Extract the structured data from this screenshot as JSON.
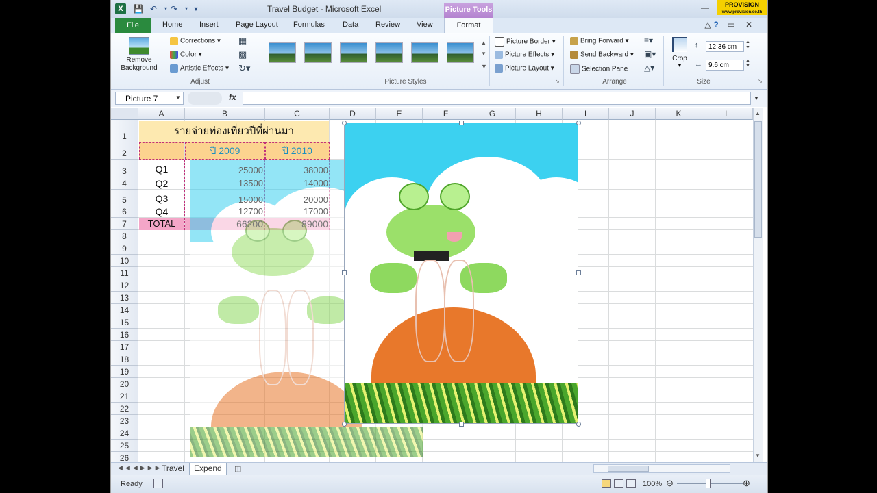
{
  "titlebar": {
    "title": "Travel Budget  -  Microsoft Excel",
    "contextual_tab": "Picture Tools",
    "brand": "PROVISION",
    "brand_sub": "www.provision.co.th"
  },
  "tabs": [
    "File",
    "Home",
    "Insert",
    "Page Layout",
    "Formulas",
    "Data",
    "Review",
    "View",
    "Format"
  ],
  "ribbon": {
    "adjust": {
      "remove_background": "Remove Background",
      "corrections": "Corrections",
      "color": "Color",
      "artistic_effects": "Artistic Effects",
      "label": "Adjust"
    },
    "picture_styles": {
      "label": "Picture Styles",
      "count": 6
    },
    "picture_options": {
      "border": "Picture Border",
      "effects": "Picture Effects",
      "layout": "Picture Layout"
    },
    "arrange": {
      "bring_forward": "Bring Forward",
      "send_backward": "Send Backward",
      "selection_pane": "Selection Pane",
      "label": "Arrange"
    },
    "size": {
      "crop": "Crop",
      "height": "12.36 cm",
      "width": "9.6 cm",
      "label": "Size"
    }
  },
  "formula_bar": {
    "name_box": "Picture 7",
    "fx": "fx",
    "value": ""
  },
  "columns": [
    "A",
    "B",
    "C",
    "D",
    "E",
    "F",
    "G",
    "H",
    "I",
    "J",
    "K",
    "L"
  ],
  "rows": [
    "1",
    "2",
    "3",
    "4",
    "5",
    "6",
    "7",
    "8",
    "9",
    "10",
    "11",
    "12",
    "13",
    "14",
    "15",
    "16",
    "17",
    "18",
    "19",
    "20",
    "21",
    "22",
    "23",
    "24",
    "25",
    "26"
  ],
  "sheet": {
    "title": "รายจ่ายท่องเที่ยวปีที่ผ่านมา",
    "year1": "ปี 2009",
    "year2": "ปี 2010",
    "table": [
      {
        "label": "Q1",
        "v2009": "25000",
        "v2010": "38000"
      },
      {
        "label": "Q2",
        "v2009": "13500",
        "v2010": "14000"
      },
      {
        "label": "Q3",
        "v2009": "15000",
        "v2010": "20000"
      },
      {
        "label": "Q4",
        "v2009": "12700",
        "v2010": "17000"
      }
    ],
    "total": {
      "label": "TOTAL",
      "v2009": "66200",
      "v2010": "89000"
    }
  },
  "sheet_tabs": [
    "Travel",
    "Expend"
  ],
  "status": {
    "ready": "Ready",
    "zoom": "100%"
  },
  "colors": {
    "title_fill": "#fde9b0",
    "year_fill": "#fcd38f",
    "total_fill": "#f4a6c8",
    "sky": "#3cd1f0",
    "mound": "#e8782b",
    "grass": "#4aa62c"
  }
}
